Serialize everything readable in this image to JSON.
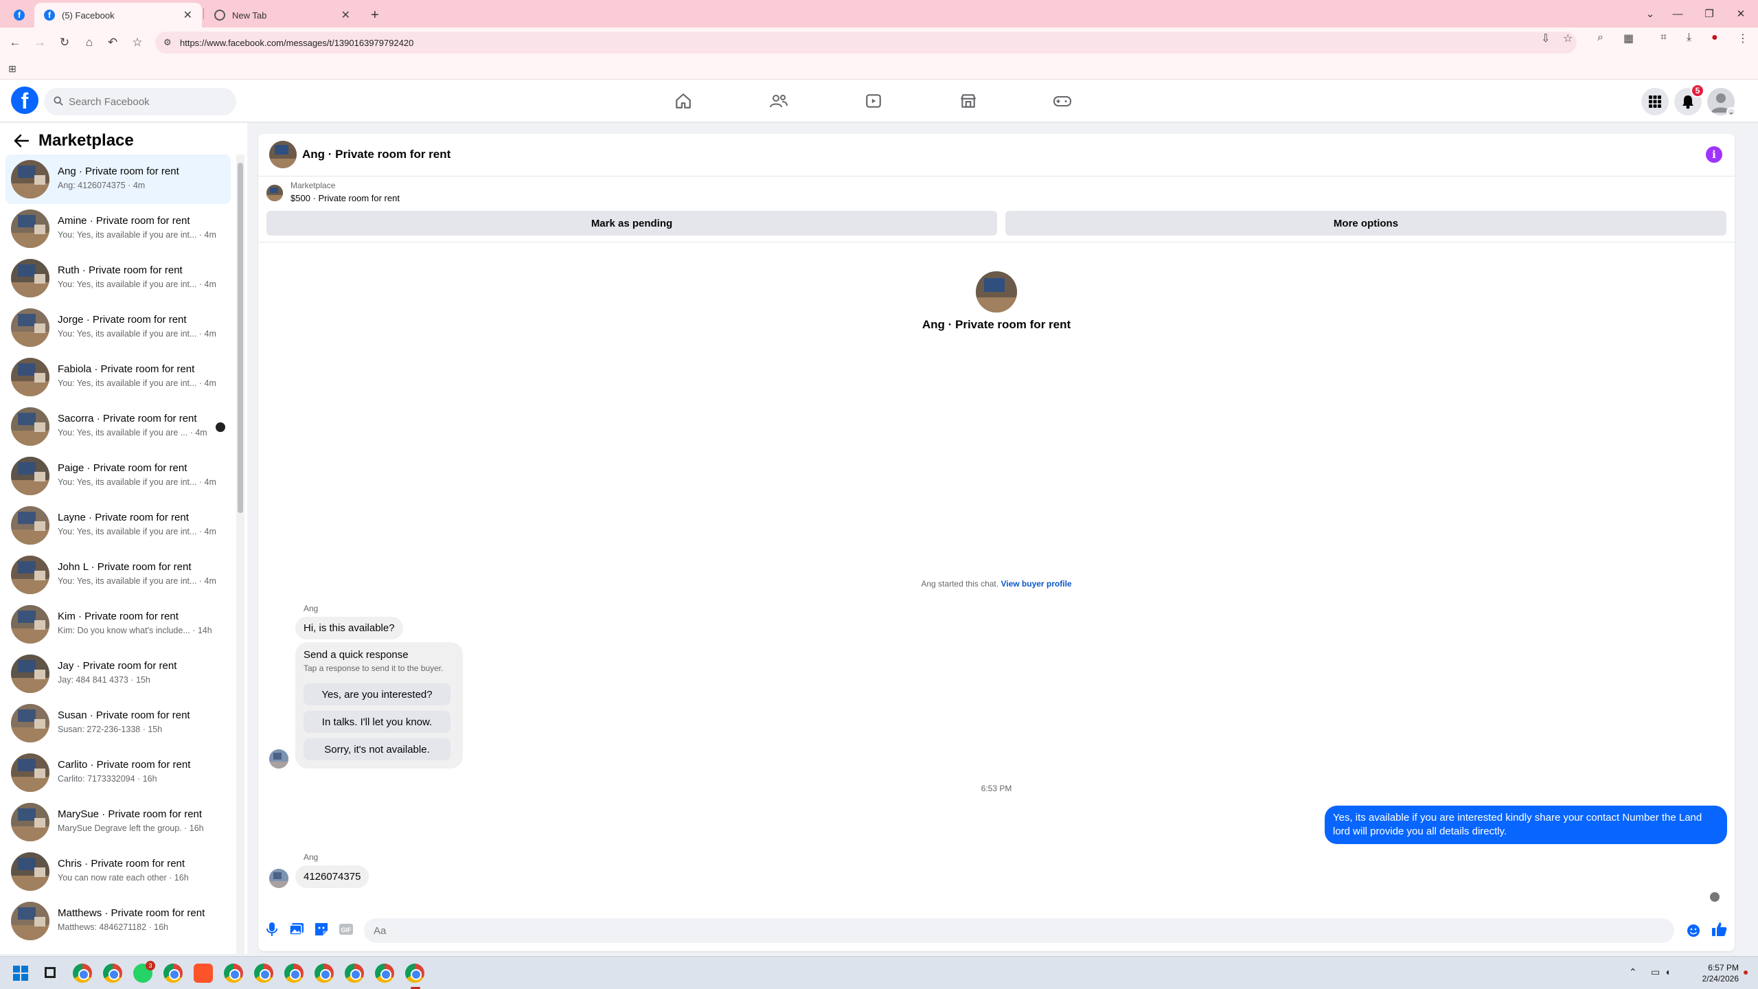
{
  "browser": {
    "tabs": [
      {
        "title": "(5) Facebook",
        "active": true
      },
      {
        "title": "New Tab",
        "active": false
      }
    ],
    "url": "https://www.facebook.com/messages/t/1390163979792420"
  },
  "facebook": {
    "search_placeholder": "Search Facebook",
    "notification_count": "5"
  },
  "sidebar": {
    "title": "Marketplace",
    "conversations": [
      {
        "name": "Ang · Private room for rent",
        "preview": "Ang: 4126074375 · 4m",
        "active": true
      },
      {
        "name": "Amine · Private room for rent",
        "preview": "You: Yes, its available if you are int... · 4m"
      },
      {
        "name": "Ruth · Private room for rent",
        "preview": "You: Yes, its available if you are int... · 4m"
      },
      {
        "name": "Jorge · Private room for rent",
        "preview": "You: Yes, its available if you are int... · 4m"
      },
      {
        "name": "Fabiola · Private room for rent",
        "preview": "You: Yes, its available if you are int... · 4m"
      },
      {
        "name": "Sacorra · Private room for rent",
        "preview": "You: Yes, its available if you are ... · 4m",
        "seen": true
      },
      {
        "name": "Paige · Private room for rent",
        "preview": "You: Yes, its available if you are int... · 4m"
      },
      {
        "name": "Layne · Private room for rent",
        "preview": "You: Yes, its available if you are int... · 4m"
      },
      {
        "name": "John L · Private room for rent",
        "preview": "You: Yes, its available if you are int... · 4m"
      },
      {
        "name": "Kim · Private room for rent",
        "preview": "Kim: Do you know what's include... · 14h"
      },
      {
        "name": "Jay · Private room for rent",
        "preview": "Jay: 484 841 4373 · 15h"
      },
      {
        "name": "Susan · Private room for rent",
        "preview": "Susan: 272-236-1338 · 15h"
      },
      {
        "name": "Carlito · Private room for rent",
        "preview": "Carlito: 7173332094 · 16h"
      },
      {
        "name": "MarySue · Private room for rent",
        "preview": "MarySue Degrave left the group. · 16h"
      },
      {
        "name": "Chris · Private room for rent",
        "preview": "You can now rate each other · 16h"
      },
      {
        "name": "Matthews · Private room for rent",
        "preview": "Matthews: 4846271182 · 16h"
      }
    ]
  },
  "chat": {
    "title": "Ang · Private room for rent",
    "listing": {
      "source": "Marketplace",
      "price_title": "$500 · Private room for rent",
      "mark_pending_label": "Mark as pending",
      "more_options_label": "More options"
    },
    "intro_title": "Ang · Private room for rent",
    "started_text": "Ang started this chat.",
    "buyer_profile_link": "View buyer profile",
    "messages": {
      "first_sender": "Ang",
      "first_message": "Hi, is this available?",
      "quick_title": "Send a quick response",
      "quick_subtitle": "Tap a response to send it to the buyer.",
      "quick_responses": [
        "Yes, are you interested?",
        "In talks. I'll let you know.",
        "Sorry, it's not available."
      ],
      "timestamp": "6:53 PM",
      "outgoing": "Yes, its available if you are interested kindly share your contact Number the Land lord will provide you all details directly.",
      "second_sender": "Ang",
      "second_message": "4126074375"
    },
    "composer_placeholder": "Aa"
  },
  "taskbar": {
    "time": "6:57 PM",
    "date": "2/24/2026",
    "badge": "3"
  },
  "colors": {
    "facebook_blue": "#0866ff",
    "info_purple": "#a033ff",
    "tabbar_pink": "#f9ccd6"
  }
}
